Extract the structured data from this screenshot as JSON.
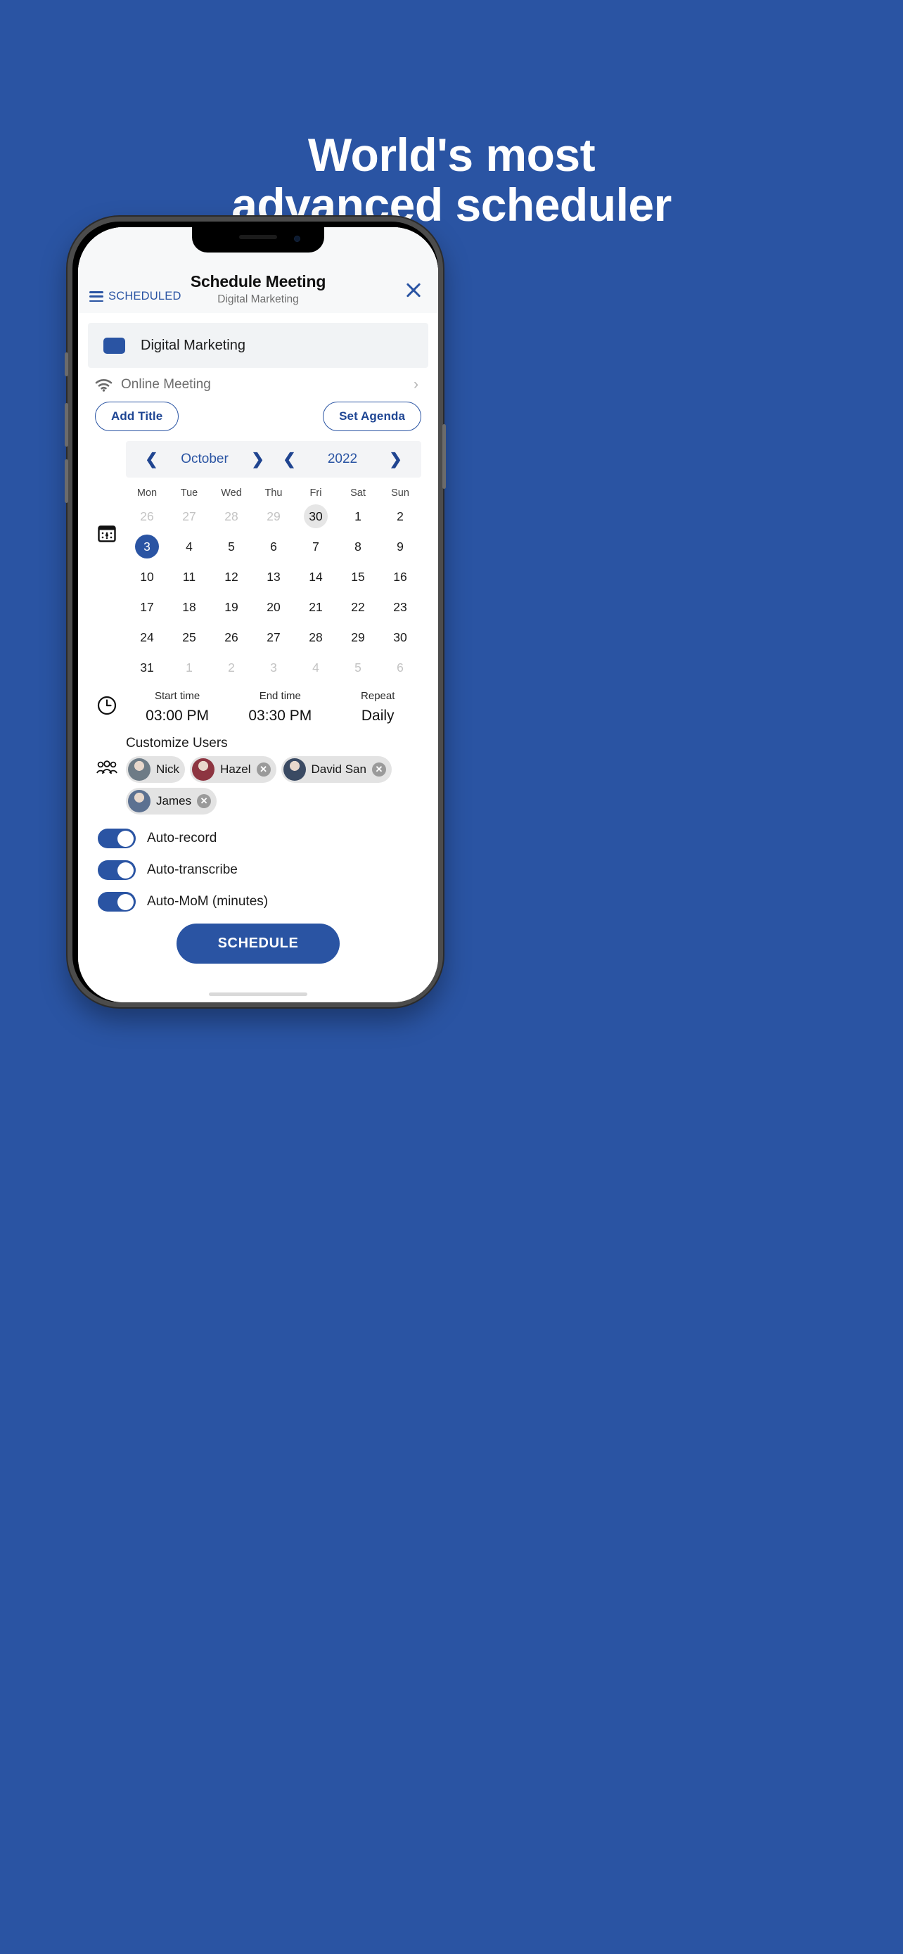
{
  "hero": {
    "line1": "World's most",
    "line2": "advanced scheduler",
    "background_color": "#2a54a3",
    "text_color": "#ffffff"
  },
  "app": {
    "header": {
      "menu_label": "SCHEDULED",
      "menu_icon": "hamburger-icon",
      "title": "Schedule Meeting",
      "subtitle": "Digital Marketing",
      "close_icon": "close-icon"
    },
    "project": {
      "color_swatch": "#2a54a3",
      "name": "Digital Marketing"
    },
    "meeting_type": {
      "icon": "wifi-icon",
      "label": "Online Meeting",
      "chevron": "›"
    },
    "actions": {
      "add_title": "Add Title",
      "set_agenda": "Set Agenda"
    },
    "calendar": {
      "icon": "calendar-icon",
      "prev_icon": "chevron-left-icon",
      "next_icon": "chevron-right-icon",
      "month": "October",
      "year": "2022",
      "weekdays": [
        "Mon",
        "Tue",
        "Wed",
        "Thu",
        "Fri",
        "Sat",
        "Sun"
      ],
      "weeks": [
        [
          {
            "d": "26",
            "state": "muted"
          },
          {
            "d": "27",
            "state": "muted"
          },
          {
            "d": "28",
            "state": "muted"
          },
          {
            "d": "29",
            "state": "muted"
          },
          {
            "d": "30",
            "state": "today"
          },
          {
            "d": "1",
            "state": "normal"
          },
          {
            "d": "2",
            "state": "normal"
          }
        ],
        [
          {
            "d": "3",
            "state": "selected"
          },
          {
            "d": "4",
            "state": "normal"
          },
          {
            "d": "5",
            "state": "normal"
          },
          {
            "d": "6",
            "state": "normal"
          },
          {
            "d": "7",
            "state": "normal"
          },
          {
            "d": "8",
            "state": "normal"
          },
          {
            "d": "9",
            "state": "normal"
          }
        ],
        [
          {
            "d": "10",
            "state": "normal"
          },
          {
            "d": "11",
            "state": "normal"
          },
          {
            "d": "12",
            "state": "normal"
          },
          {
            "d": "13",
            "state": "normal"
          },
          {
            "d": "14",
            "state": "normal"
          },
          {
            "d": "15",
            "state": "normal"
          },
          {
            "d": "16",
            "state": "normal"
          }
        ],
        [
          {
            "d": "17",
            "state": "normal"
          },
          {
            "d": "18",
            "state": "normal"
          },
          {
            "d": "19",
            "state": "normal"
          },
          {
            "d": "20",
            "state": "normal"
          },
          {
            "d": "21",
            "state": "normal"
          },
          {
            "d": "22",
            "state": "normal"
          },
          {
            "d": "23",
            "state": "normal"
          }
        ],
        [
          {
            "d": "24",
            "state": "normal"
          },
          {
            "d": "25",
            "state": "normal"
          },
          {
            "d": "26",
            "state": "normal"
          },
          {
            "d": "27",
            "state": "normal"
          },
          {
            "d": "28",
            "state": "normal"
          },
          {
            "d": "29",
            "state": "normal"
          },
          {
            "d": "30",
            "state": "normal"
          }
        ],
        [
          {
            "d": "31",
            "state": "normal"
          },
          {
            "d": "1",
            "state": "muted"
          },
          {
            "d": "2",
            "state": "muted"
          },
          {
            "d": "3",
            "state": "muted"
          },
          {
            "d": "4",
            "state": "muted"
          },
          {
            "d": "5",
            "state": "muted"
          },
          {
            "d": "6",
            "state": "muted"
          }
        ]
      ]
    },
    "time": {
      "icon": "clock-icon",
      "start_label": "Start time",
      "start_value": "03:00 PM",
      "end_label": "End time",
      "end_value": "03:30 PM",
      "repeat_label": "Repeat",
      "repeat_value": "Daily"
    },
    "users": {
      "icon": "people-icon",
      "title": "Customize Users",
      "chips": [
        {
          "name": "Nick",
          "removable": false,
          "avatar_color": "#6d7b86"
        },
        {
          "name": "Hazel",
          "removable": true,
          "avatar_color": "#8d3541"
        },
        {
          "name": "David San",
          "removable": true,
          "avatar_color": "#3a4a63"
        },
        {
          "name": "James",
          "removable": true,
          "avatar_color": "#5c7191"
        }
      ],
      "remove_icon": "close-circle-icon"
    },
    "toggles": [
      {
        "label": "Auto-record",
        "on": true
      },
      {
        "label": "Auto-transcribe",
        "on": true
      },
      {
        "label": "Auto-MoM (minutes)",
        "on": true
      }
    ],
    "submit": {
      "label": "SCHEDULE",
      "color": "#2a54a3"
    }
  }
}
